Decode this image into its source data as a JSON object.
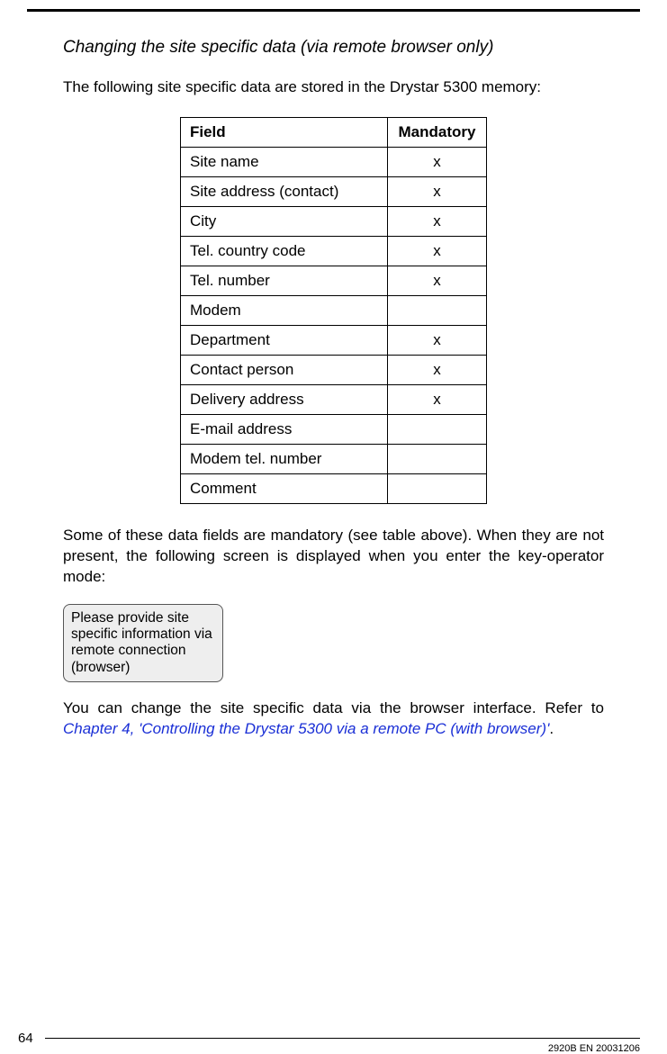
{
  "section_title": "Changing the site specific data (via remote browser only)",
  "intro": "The following site specific data are stored in the Drystar 5300 memory:",
  "table": {
    "headers": {
      "field": "Field",
      "mandatory": "Mandatory"
    },
    "rows": [
      {
        "field": "Site name",
        "mandatory": "x"
      },
      {
        "field": "Site address (contact)",
        "mandatory": "x"
      },
      {
        "field": "City",
        "mandatory": "x"
      },
      {
        "field": "Tel. country code",
        "mandatory": "x"
      },
      {
        "field": "Tel. number",
        "mandatory": "x"
      },
      {
        "field": "Modem",
        "mandatory": ""
      },
      {
        "field": "Department",
        "mandatory": "x"
      },
      {
        "field": "Contact person",
        "mandatory": "x"
      },
      {
        "field": "Delivery address",
        "mandatory": "x"
      },
      {
        "field": "E-mail address",
        "mandatory": ""
      },
      {
        "field": "Modem tel. number",
        "mandatory": ""
      },
      {
        "field": "Comment",
        "mandatory": ""
      }
    ]
  },
  "para_mandatory": "Some of these data fields are mandatory (see table above). When they are not present, the following screen is displayed when you enter the key-operator mode:",
  "screen_box": "Please provide site specific information via remote connection (browser)",
  "para_after_pre": "You can change the site specific data via the browser interface. Refer to ",
  "link_text": "Chapter 4, 'Controlling the Drystar 5300 via a remote PC (with browser)'",
  "para_after_post": ".",
  "page_number": "64",
  "doc_id": "2920B EN 20031206"
}
